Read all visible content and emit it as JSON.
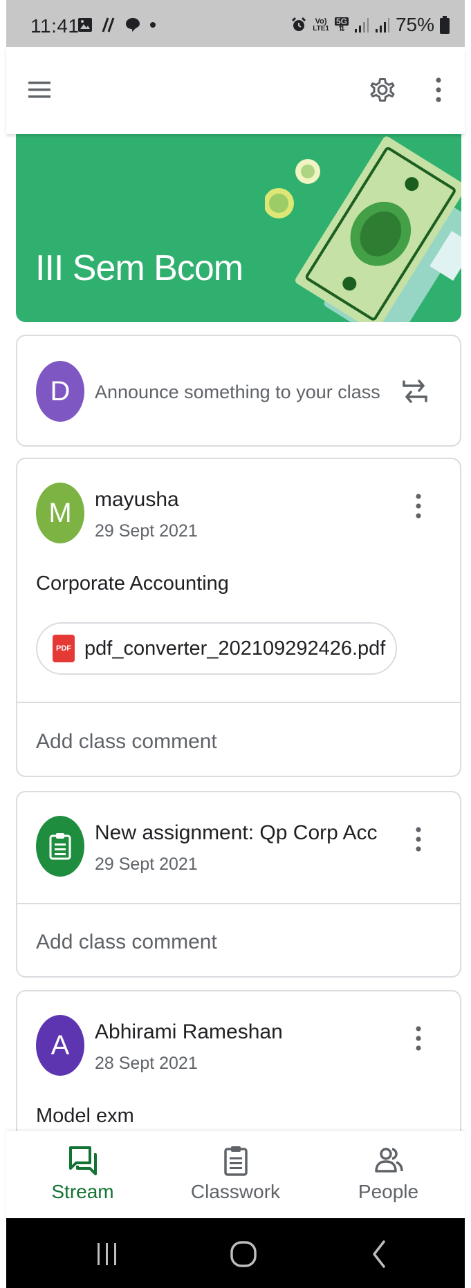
{
  "status_bar": {
    "time": "11:41",
    "battery": "75%",
    "network_top": "Vo)",
    "network_bottom": "LTE1",
    "network_5g": "5G"
  },
  "class": {
    "title": "III Sem Bcom",
    "banner_color": "#2fb06e"
  },
  "announce": {
    "avatar_letter": "D",
    "avatar_color": "#7e57c2",
    "placeholder": "Announce something to your class"
  },
  "posts": [
    {
      "avatar_letter": "M",
      "avatar_color": "#7cb342",
      "author": "mayusha",
      "date": "29 Sept 2021",
      "body": "Corporate Accounting",
      "attachment_badge": "PDF",
      "attachment": "pdf_converter_202109292426.pdf",
      "comment": "Add class comment"
    },
    {
      "avatar_icon": "assignment-icon",
      "avatar_color": "#1e8e3e",
      "author": "New assignment: Qp Corp Acc",
      "date": "29 Sept 2021",
      "comment": "Add class comment"
    },
    {
      "avatar_letter": "A",
      "avatar_color": "#5e35b1",
      "author": "Abhirami Rameshan",
      "date": "28 Sept 2021",
      "body": "Model exm"
    }
  ],
  "bottom_nav": [
    {
      "label": "Stream",
      "icon": "stream-icon",
      "active": true
    },
    {
      "label": "Classwork",
      "icon": "classwork-icon",
      "active": false
    },
    {
      "label": "People",
      "icon": "people-icon",
      "active": false
    }
  ],
  "colors": {
    "active_nav": "#137333",
    "status_bar": "#c7c7c7",
    "border": "#dadce0"
  }
}
